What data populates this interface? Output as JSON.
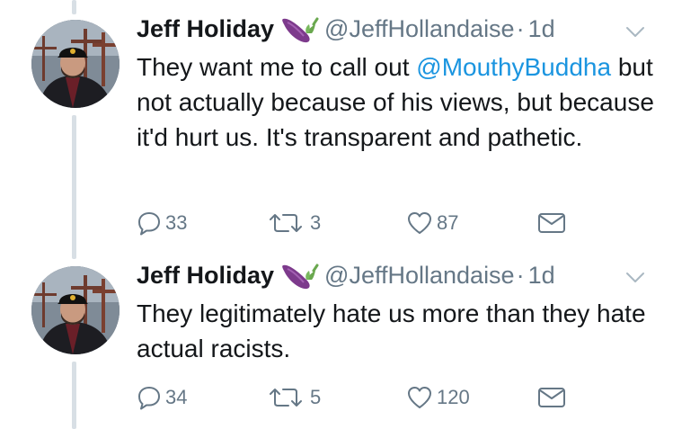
{
  "tweets": [
    {
      "author_name": "Jeff Holiday",
      "author_emoji": "eggplant-emoji",
      "handle": "@JeffHollandaise",
      "separator": "·",
      "time": "1d",
      "text_before_mention": "They want me to call out ",
      "mention": "@MouthyBuddha",
      "text_after_mention": " but not actually because of his views, but because it'd hurt us. It's transparent and pathetic.",
      "replies": "33",
      "retweets": "3",
      "likes": "87"
    },
    {
      "author_name": "Jeff Holiday",
      "author_emoji": "eggplant-emoji",
      "handle": "@JeffHollandaise",
      "separator": "·",
      "time": "1d",
      "text": "They legitimately hate us more than they hate actual racists.",
      "replies": "34",
      "retweets": "5",
      "likes": "120"
    }
  ],
  "colors": {
    "name": "#14171a",
    "secondary": "#657786",
    "mention": "#1b95e0",
    "thread_line": "#d8dfe5"
  },
  "icons": [
    "reply-icon",
    "retweet-icon",
    "like-icon",
    "direct-message-icon",
    "chevron-down-icon",
    "eggplant-emoji"
  ]
}
